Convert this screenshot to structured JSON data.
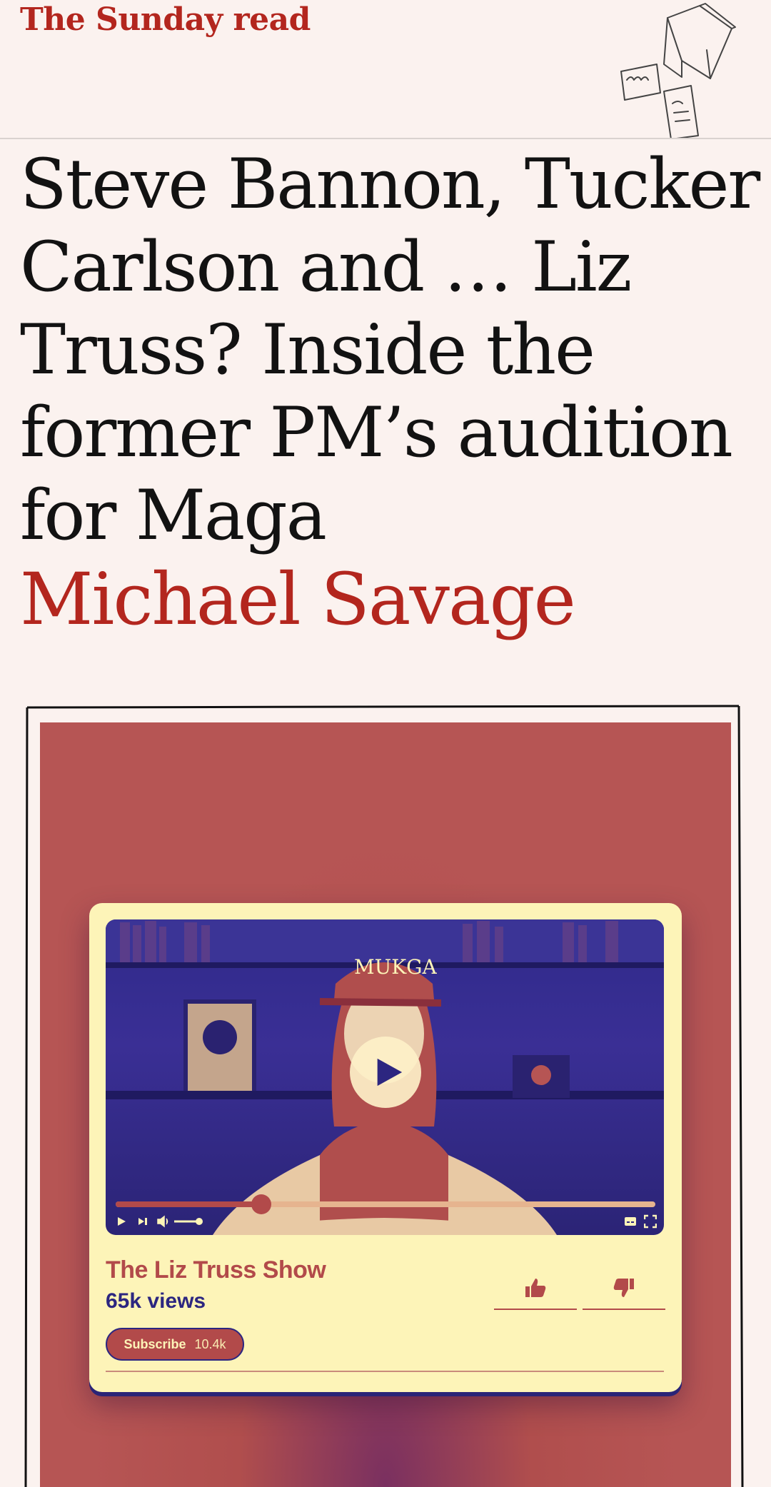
{
  "section": {
    "kicker": "The Sunday read"
  },
  "article": {
    "headline": "Steve Bannon, Tucker Carlson and … Liz Truss? Inside the former PM’s audition for Maga",
    "byline": "Michael Savage"
  },
  "illustration": {
    "cap_text": "MUKGA",
    "video": {
      "progress_fraction": 0.27
    },
    "channel": {
      "title": "The Liz Truss Show",
      "views": "65k views",
      "subscribe_label": "Subscribe",
      "subscriber_count": "10.4k"
    },
    "icons": [
      "play-icon",
      "skip-icon",
      "volume-icon",
      "captions-icon",
      "fullscreen-icon",
      "thumbs-up-icon",
      "thumbs-down-icon"
    ]
  },
  "colors": {
    "brand_red": "#b3261e",
    "headline": "#121212",
    "background": "#fbf2ef",
    "illustration_red": "#b65554",
    "card_cream": "#fdf4b8",
    "accent_navy": "#2c2680"
  }
}
